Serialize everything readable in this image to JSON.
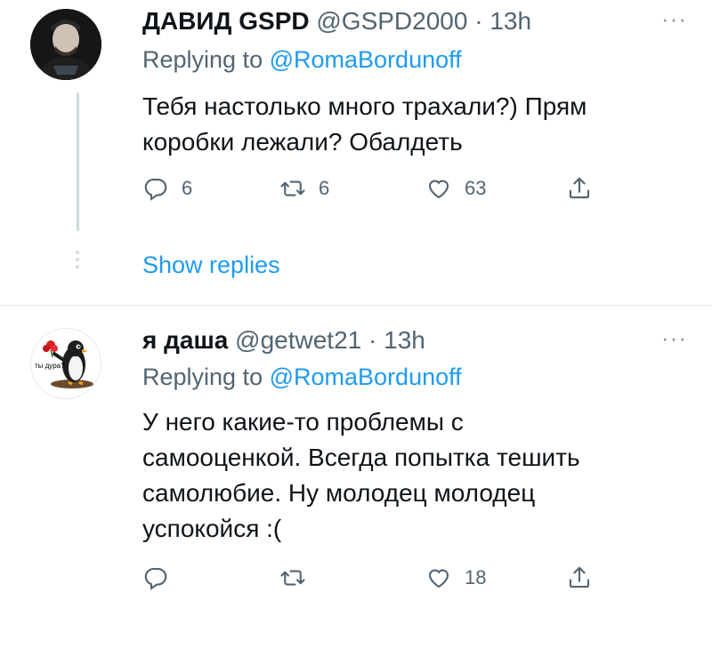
{
  "tweets": [
    {
      "name": "ДАВИД GSPD",
      "handle": "@GSPD2000",
      "separator": "·",
      "time": "13h",
      "more": "···",
      "replying_prefix": "Replying to",
      "replying_to": "@RomaBordunoff",
      "text_lines": [
        "Тебя настолько много трахали?) Прям",
        "коробки лежали? Обалдеть"
      ],
      "reply_count": "6",
      "retweet_count": "6",
      "like_count": "63",
      "show_replies": "Show replies"
    },
    {
      "name": "я даша",
      "handle": "@getwet21",
      "separator": "·",
      "time": "13h",
      "more": "···",
      "avatar_caption": "ты дура?",
      "replying_prefix": "Replying to",
      "replying_to": "@RomaBordunoff",
      "text_lines": [
        "У него какие-то проблемы с",
        "самооценкой. Всегда попытка тешить",
        "самолюбие. Ну молодец молодец",
        "успокойся :("
      ],
      "reply_count": "",
      "retweet_count": "",
      "like_count": "18"
    }
  ],
  "colors": {
    "accent": "#1d9bf0",
    "secondary_text": "#536471",
    "divider": "#e1e8ed",
    "thread_line": "#cfd9de"
  },
  "icons": [
    "reply-icon",
    "retweet-icon",
    "like-icon",
    "share-icon",
    "more-icon"
  ]
}
